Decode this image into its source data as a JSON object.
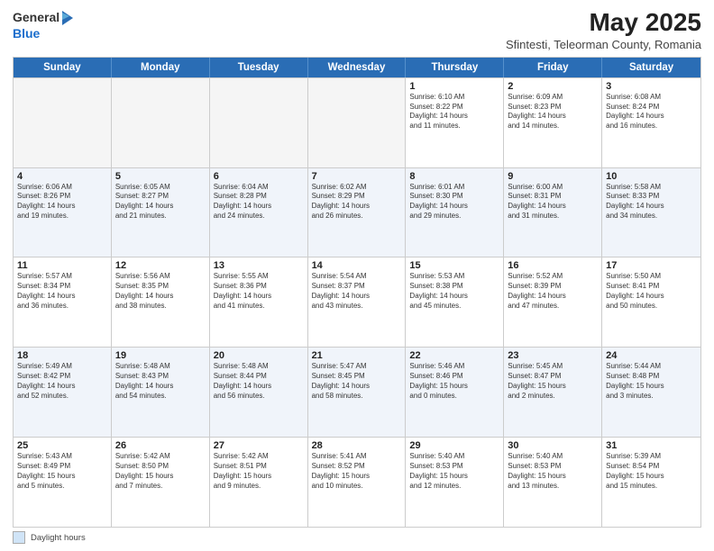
{
  "header": {
    "logo_general": "General",
    "logo_blue": "Blue",
    "month_title": "May 2025",
    "subtitle": "Sfintesti, Teleorman County, Romania"
  },
  "days_of_week": [
    "Sunday",
    "Monday",
    "Tuesday",
    "Wednesday",
    "Thursday",
    "Friday",
    "Saturday"
  ],
  "footer": {
    "daylight_label": "Daylight hours"
  },
  "weeks": [
    {
      "cells": [
        {
          "day": "",
          "info": "",
          "empty": true
        },
        {
          "day": "",
          "info": "",
          "empty": true
        },
        {
          "day": "",
          "info": "",
          "empty": true
        },
        {
          "day": "",
          "info": "",
          "empty": true
        },
        {
          "day": "1",
          "info": "Sunrise: 6:10 AM\nSunset: 8:22 PM\nDaylight: 14 hours\nand 11 minutes."
        },
        {
          "day": "2",
          "info": "Sunrise: 6:09 AM\nSunset: 8:23 PM\nDaylight: 14 hours\nand 14 minutes."
        },
        {
          "day": "3",
          "info": "Sunrise: 6:08 AM\nSunset: 8:24 PM\nDaylight: 14 hours\nand 16 minutes."
        }
      ]
    },
    {
      "cells": [
        {
          "day": "4",
          "info": "Sunrise: 6:06 AM\nSunset: 8:26 PM\nDaylight: 14 hours\nand 19 minutes."
        },
        {
          "day": "5",
          "info": "Sunrise: 6:05 AM\nSunset: 8:27 PM\nDaylight: 14 hours\nand 21 minutes."
        },
        {
          "day": "6",
          "info": "Sunrise: 6:04 AM\nSunset: 8:28 PM\nDaylight: 14 hours\nand 24 minutes."
        },
        {
          "day": "7",
          "info": "Sunrise: 6:02 AM\nSunset: 8:29 PM\nDaylight: 14 hours\nand 26 minutes."
        },
        {
          "day": "8",
          "info": "Sunrise: 6:01 AM\nSunset: 8:30 PM\nDaylight: 14 hours\nand 29 minutes."
        },
        {
          "day": "9",
          "info": "Sunrise: 6:00 AM\nSunset: 8:31 PM\nDaylight: 14 hours\nand 31 minutes."
        },
        {
          "day": "10",
          "info": "Sunrise: 5:58 AM\nSunset: 8:33 PM\nDaylight: 14 hours\nand 34 minutes."
        }
      ]
    },
    {
      "cells": [
        {
          "day": "11",
          "info": "Sunrise: 5:57 AM\nSunset: 8:34 PM\nDaylight: 14 hours\nand 36 minutes."
        },
        {
          "day": "12",
          "info": "Sunrise: 5:56 AM\nSunset: 8:35 PM\nDaylight: 14 hours\nand 38 minutes."
        },
        {
          "day": "13",
          "info": "Sunrise: 5:55 AM\nSunset: 8:36 PM\nDaylight: 14 hours\nand 41 minutes."
        },
        {
          "day": "14",
          "info": "Sunrise: 5:54 AM\nSunset: 8:37 PM\nDaylight: 14 hours\nand 43 minutes."
        },
        {
          "day": "15",
          "info": "Sunrise: 5:53 AM\nSunset: 8:38 PM\nDaylight: 14 hours\nand 45 minutes."
        },
        {
          "day": "16",
          "info": "Sunrise: 5:52 AM\nSunset: 8:39 PM\nDaylight: 14 hours\nand 47 minutes."
        },
        {
          "day": "17",
          "info": "Sunrise: 5:50 AM\nSunset: 8:41 PM\nDaylight: 14 hours\nand 50 minutes."
        }
      ]
    },
    {
      "cells": [
        {
          "day": "18",
          "info": "Sunrise: 5:49 AM\nSunset: 8:42 PM\nDaylight: 14 hours\nand 52 minutes."
        },
        {
          "day": "19",
          "info": "Sunrise: 5:48 AM\nSunset: 8:43 PM\nDaylight: 14 hours\nand 54 minutes."
        },
        {
          "day": "20",
          "info": "Sunrise: 5:48 AM\nSunset: 8:44 PM\nDaylight: 14 hours\nand 56 minutes."
        },
        {
          "day": "21",
          "info": "Sunrise: 5:47 AM\nSunset: 8:45 PM\nDaylight: 14 hours\nand 58 minutes."
        },
        {
          "day": "22",
          "info": "Sunrise: 5:46 AM\nSunset: 8:46 PM\nDaylight: 15 hours\nand 0 minutes."
        },
        {
          "day": "23",
          "info": "Sunrise: 5:45 AM\nSunset: 8:47 PM\nDaylight: 15 hours\nand 2 minutes."
        },
        {
          "day": "24",
          "info": "Sunrise: 5:44 AM\nSunset: 8:48 PM\nDaylight: 15 hours\nand 3 minutes."
        }
      ]
    },
    {
      "cells": [
        {
          "day": "25",
          "info": "Sunrise: 5:43 AM\nSunset: 8:49 PM\nDaylight: 15 hours\nand 5 minutes."
        },
        {
          "day": "26",
          "info": "Sunrise: 5:42 AM\nSunset: 8:50 PM\nDaylight: 15 hours\nand 7 minutes."
        },
        {
          "day": "27",
          "info": "Sunrise: 5:42 AM\nSunset: 8:51 PM\nDaylight: 15 hours\nand 9 minutes."
        },
        {
          "day": "28",
          "info": "Sunrise: 5:41 AM\nSunset: 8:52 PM\nDaylight: 15 hours\nand 10 minutes."
        },
        {
          "day": "29",
          "info": "Sunrise: 5:40 AM\nSunset: 8:53 PM\nDaylight: 15 hours\nand 12 minutes."
        },
        {
          "day": "30",
          "info": "Sunrise: 5:40 AM\nSunset: 8:53 PM\nDaylight: 15 hours\nand 13 minutes."
        },
        {
          "day": "31",
          "info": "Sunrise: 5:39 AM\nSunset: 8:54 PM\nDaylight: 15 hours\nand 15 minutes."
        }
      ]
    }
  ]
}
